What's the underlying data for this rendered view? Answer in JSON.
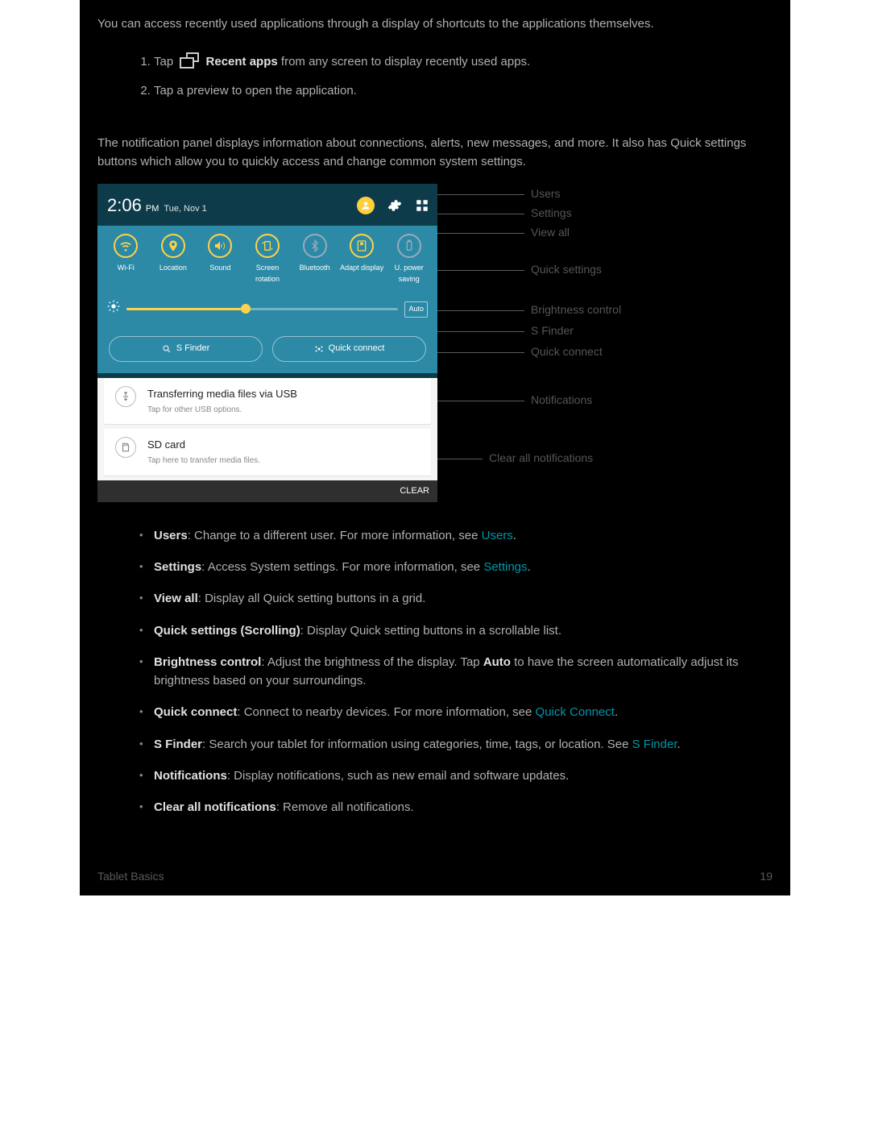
{
  "intro": "You can access recently used applications through a display of shortcuts to the applications themselves.",
  "steps": {
    "step1_prefix": "Tap",
    "step1_bold": "Recent apps",
    "step1_suffix": " from any screen to display recently used apps.",
    "step2": "Tap a preview to open the application."
  },
  "panel_paragraph": "The notification panel displays information about connections, alerts, new messages, and more. It also has Quick settings buttons which allow you to quickly access and change common system settings.",
  "screenshot": {
    "time": "2:06",
    "ampm": "PM",
    "date": "Tue, Nov 1",
    "qs": [
      "Wi-Fi",
      "Location",
      "Sound",
      "Screen rotation",
      "Bluetooth",
      "Adapt display",
      "U. power saving"
    ],
    "auto_label": "Auto",
    "sfinder": "S Finder",
    "quickconnect": "Quick connect",
    "notif1_title": "Transferring media files via USB",
    "notif1_sub": "Tap for other USB options.",
    "notif2_title": "SD card",
    "notif2_sub": "Tap here to transfer media files.",
    "clear": "CLEAR"
  },
  "callouts": {
    "users": "Users",
    "settings": "Settings",
    "viewall": "View all",
    "quicksettings": "Quick settings",
    "brightness": "Brightness control",
    "sfinder": "S Finder",
    "quickconnect": "Quick connect",
    "notifications": "Notifications",
    "clearall": "Clear all notifications"
  },
  "bullets": {
    "users": {
      "bold": "Users",
      "text": ": Change to a different user. For more information, see ",
      "link": "Users",
      "tail": "."
    },
    "settings": {
      "bold": "Settings",
      "text": ": Access System settings. For more information, see ",
      "link": "Settings",
      "tail": "."
    },
    "viewall": {
      "bold": "View all",
      "text": ": Display all Quick setting buttons in a grid."
    },
    "qs": {
      "bold": "Quick settings (Scrolling)",
      "text": ": Display Quick setting buttons in a scrollable list."
    },
    "brightness": {
      "bold": "Brightness control",
      "text": ": Adjust the brightness of the display. Tap ",
      "bold2": "Auto",
      "text2": " to have the screen automatically adjust its brightness based on your surroundings."
    },
    "qc": {
      "bold": "Quick connect",
      "text": ": Connect to nearby devices. For more information, see ",
      "link": "Quick Connect",
      "tail": "."
    },
    "sfinder": {
      "bold": "S Finder",
      "text": ": Search your tablet for information using categories, time, tags, or location. See ",
      "link": "S Finder",
      "tail": "."
    },
    "notif": {
      "bold": "Notifications",
      "text": ": Display notifications, such as new email and software updates."
    },
    "clear": {
      "bold": "Clear all notifications",
      "text": ": Remove all notifications."
    }
  },
  "footer": {
    "section": "Tablet Basics",
    "page": "19"
  }
}
